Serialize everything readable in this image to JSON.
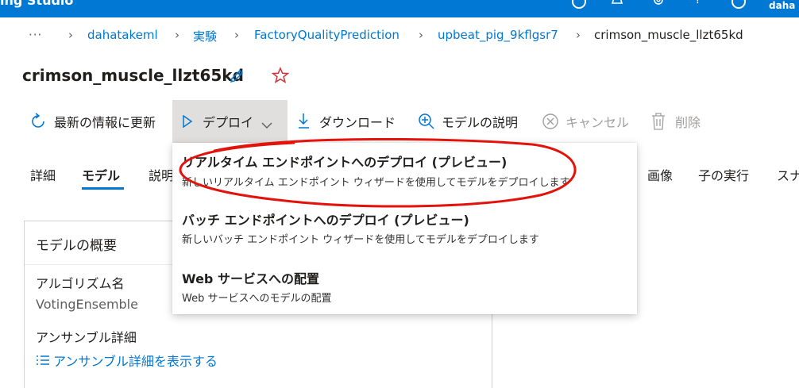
{
  "app": {
    "title_fragment": "ing Studio",
    "user_fragment": "daha"
  },
  "breadcrumb": {
    "more": "···",
    "items": [
      "dahatakeml",
      "実験",
      "FactoryQualityPrediction",
      "upbeat_pig_9kflgsr7",
      "crimson_muscle_llzt65kd"
    ]
  },
  "page": {
    "title": "crimson_muscle_llzt65kd"
  },
  "toolbar": {
    "refresh": "最新の情報に更新",
    "deploy": "デプロイ",
    "download": "ダウンロード",
    "explain": "モデルの説明",
    "cancel": "キャンセル",
    "delete": "削除"
  },
  "tabs": {
    "details": "詳細",
    "model": "モデル",
    "explanations": "説明",
    "images": "画像",
    "child_runs": "子の実行",
    "snapshot": "スナ"
  },
  "card": {
    "title": "モデルの概要",
    "algorithm_label": "アルゴリズム名",
    "algorithm_value": "VotingEnsemble",
    "ensemble_label": "アンサンブル詳細",
    "ensemble_link": "アンサンブル詳細を表示する"
  },
  "deploy_menu": {
    "items": [
      {
        "title": "リアルタイム エンドポイントへのデプロイ (プレビュー)",
        "desc": "新しいリアルタイム エンドポイント ウィザードを使用してモデルをデプロイします"
      },
      {
        "title": "バッチ エンドポイントへのデプロイ (プレビュー)",
        "desc": "新しいバッチ エンドポイント ウィザードを使用してモデルをデプロイします"
      },
      {
        "title": "Web サービスへの配置",
        "desc": "Web サービスへのモデルの配置"
      }
    ]
  },
  "colors": {
    "accent": "#0078d4",
    "annotation": "#e3120b",
    "star": "#d13438"
  }
}
